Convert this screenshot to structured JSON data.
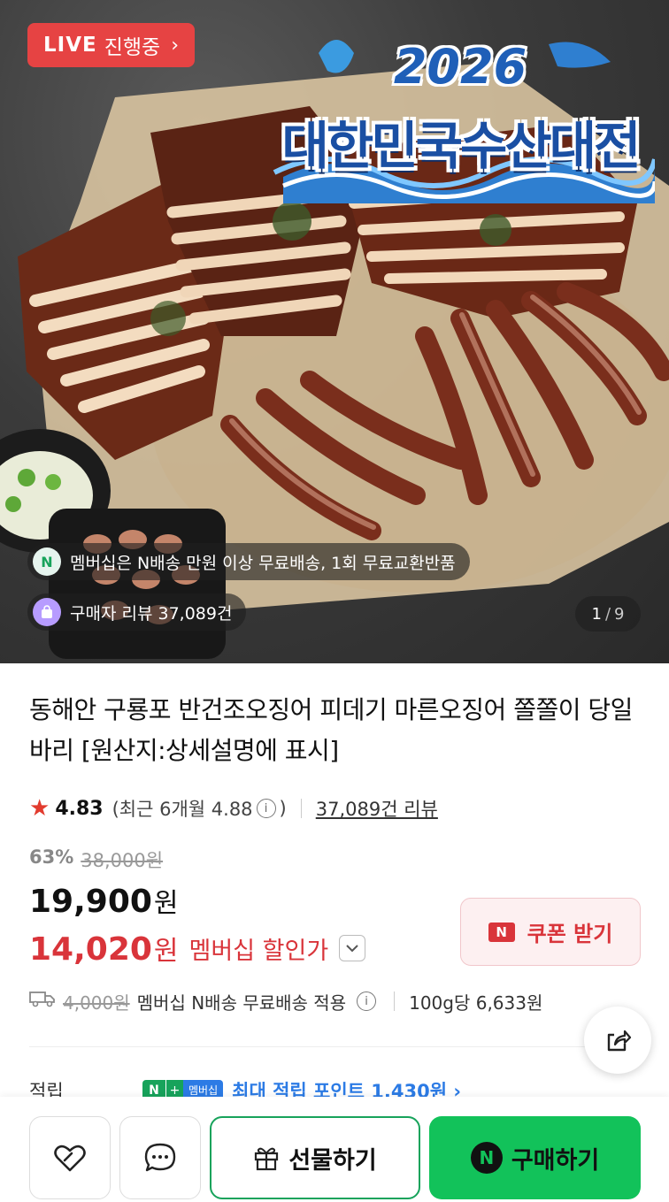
{
  "hero": {
    "live_badge": {
      "live": "LIVE",
      "label": "진행중",
      "chevron": "›"
    },
    "event": {
      "year": "2026",
      "title": "대한민국수산대전"
    },
    "membership_chip": {
      "icon": "N",
      "text": "멤버십은 N배송 만원 이상 무료배송, 1회 무료교환반품"
    },
    "review_chip": {
      "icon": "bag-icon",
      "text": "구매자 리뷰 37,089건"
    },
    "counter": {
      "current": "1",
      "separator": "/",
      "total": "9"
    }
  },
  "product": {
    "title": "동해안 구룡포 반건조오징어 피데기 마른오징어 쫄쫄이 당일바리 [원산지:상세설명에 표시]",
    "rating": {
      "star": "★",
      "score": "4.83",
      "recent_prefix": "(최근 6개월 4.88",
      "info_icon": "i",
      "recent_suffix": ")",
      "review_link": "37,089건 리뷰"
    },
    "price": {
      "discount_rate": "63%",
      "original": "38,000원",
      "sale_amount": "19,900",
      "sale_unit": "원",
      "member_amount": "14,020",
      "member_unit": "원",
      "member_label": "멤버십 할인가",
      "dropdown": "⌄"
    },
    "coupon": {
      "logo": "N",
      "label": "쿠폰 받기"
    },
    "shipping": {
      "fee": "4,000원",
      "text": "멤버십 N배송 무료배송 적용",
      "info_icon": "i",
      "unit_price": "100g당 6,633원"
    },
    "points": {
      "label": "적립",
      "badge_n": "N",
      "badge_plus": "+",
      "badge_membership": "멤버십",
      "text": "최대 적립 포인트 1,430원 ›"
    }
  },
  "bottom_bar": {
    "gift_label": "선물하기",
    "buy_logo": "N",
    "buy_label": "구매하기"
  },
  "colors": {
    "live_red": "#e64343",
    "member_red": "#d9343a",
    "naver_green": "#12c25a",
    "points_blue": "#2c7be5"
  }
}
